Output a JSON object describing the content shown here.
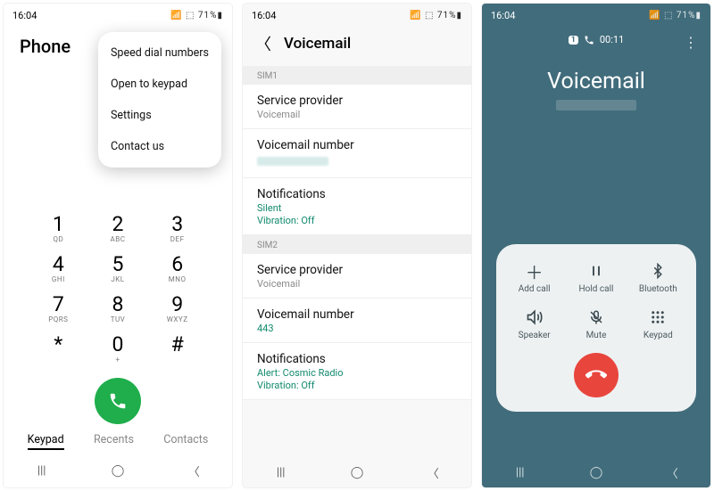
{
  "status": {
    "time": "16:04",
    "right": "71%"
  },
  "screen1": {
    "title": "Phone",
    "menu": [
      "Speed dial numbers",
      "Open to keypad",
      "Settings",
      "Contact us"
    ],
    "keys": [
      {
        "d": "1",
        "l": "QD"
      },
      {
        "d": "2",
        "l": "ABC"
      },
      {
        "d": "3",
        "l": "DEF"
      },
      {
        "d": "4",
        "l": "GHI"
      },
      {
        "d": "5",
        "l": "JKL"
      },
      {
        "d": "6",
        "l": "MNO"
      },
      {
        "d": "7",
        "l": "PQRS"
      },
      {
        "d": "8",
        "l": "TUV"
      },
      {
        "d": "9",
        "l": "WXYZ"
      },
      {
        "d": "*",
        "l": ""
      },
      {
        "d": "0",
        "l": "+"
      },
      {
        "d": "#",
        "l": ""
      }
    ],
    "tabs": {
      "keypad": "Keypad",
      "recents": "Recents",
      "contacts": "Contacts"
    }
  },
  "screen2": {
    "title": "Voicemail",
    "sim1_label": "SIM1",
    "sim2_label": "SIM2",
    "sp_title": "Service provider",
    "sp_sub": "Voicemail",
    "vn_title": "Voicemail number",
    "vn2_value": "443",
    "notif_title": "Notifications",
    "notif1_line1": "Silent",
    "notif1_line2": "Vibration: Off",
    "notif2_line1": "Alert: Cosmic Radio",
    "notif2_line2": "Vibration: Off"
  },
  "screen3": {
    "sim": "1",
    "timer": "00:11",
    "title": "Voicemail",
    "controls": {
      "add": "Add call",
      "hold": "Hold call",
      "bt": "Bluetooth",
      "speaker": "Speaker",
      "mute": "Mute",
      "keypad": "Keypad"
    }
  }
}
